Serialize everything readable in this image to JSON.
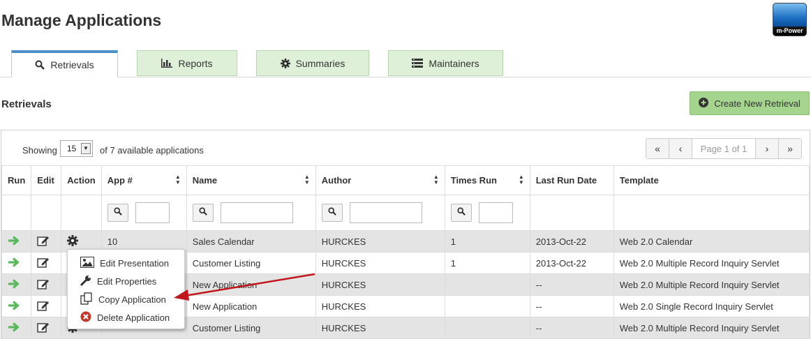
{
  "header": {
    "title": "Manage Applications",
    "logo_text": "m-Power"
  },
  "tabs": [
    {
      "label": "Retrievals",
      "icon": "search-icon",
      "active": true
    },
    {
      "label": "Reports",
      "icon": "bar-chart-icon",
      "active": false
    },
    {
      "label": "Summaries",
      "icon": "gear-icon",
      "active": false
    },
    {
      "label": "Maintainers",
      "icon": "list-icon",
      "active": false
    }
  ],
  "section": {
    "title": "Retrievals",
    "create_label": "Create New Retrieval"
  },
  "toolbar": {
    "showing_label": "Showing",
    "page_size": "15",
    "available_label": "of 7 available applications",
    "page_info": "Page 1 of 1"
  },
  "table": {
    "columns": [
      "Run",
      "Edit",
      "Action",
      "App #",
      "Name",
      "Author",
      "Times Run",
      "Last Run Date",
      "Template"
    ],
    "rows": [
      {
        "app": "10",
        "name": "Sales Calendar",
        "author": "HURCKES",
        "times": "1",
        "date": "2013-Oct-22",
        "template": "Web 2.0 Calendar"
      },
      {
        "app": "",
        "name": "Customer Listing",
        "author": "HURCKES",
        "times": "1",
        "date": "2013-Oct-22",
        "template": "Web 2.0 Multiple Record Inquiry Servlet"
      },
      {
        "app": "",
        "name": "New Application",
        "author": "HURCKES",
        "times": "",
        "date": "--",
        "template": "Web 2.0 Multiple Record Inquiry Servlet"
      },
      {
        "app": "",
        "name": "New Application",
        "author": "HURCKES",
        "times": "",
        "date": "--",
        "template": "Web 2.0 Single Record Inquiry Servlet"
      },
      {
        "app": "",
        "name": "Customer Listing",
        "author": "HURCKES",
        "times": "",
        "date": "--",
        "template": "Web 2.0 Multiple Record Inquiry Servlet"
      }
    ]
  },
  "context_menu": {
    "items": [
      {
        "label": "Edit Presentation",
        "icon": "image-icon"
      },
      {
        "label": "Edit Properties",
        "icon": "wrench-icon"
      },
      {
        "label": "Copy Application",
        "icon": "copy-icon"
      },
      {
        "label": "Delete Application",
        "icon": "delete-icon"
      }
    ]
  },
  "colors": {
    "tab_bg": "#dff0d8",
    "tab_active_border": "#4a8fc7",
    "create_btn": "#a4d48e",
    "run_arrow": "#5cb85c",
    "annotation_arrow": "#c0161b"
  }
}
